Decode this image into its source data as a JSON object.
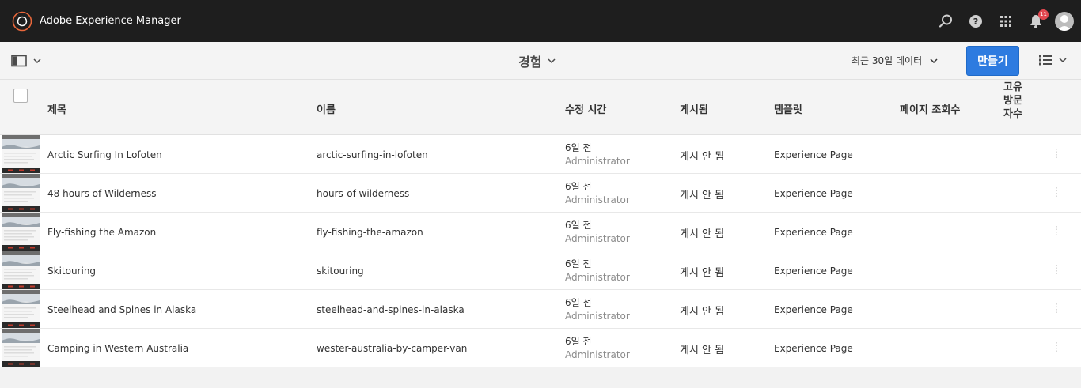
{
  "shell": {
    "app_title": "Adobe Experience Manager",
    "notification_count": "11",
    "icons": [
      "adobe-logo-icon",
      "search-icon",
      "help-icon",
      "solutions-grid-icon",
      "bell-icon",
      "user-avatar"
    ]
  },
  "actionbar": {
    "page_title": "경험",
    "period": "최근 30일 데이터",
    "create_label": "만들기"
  },
  "table": {
    "columns": {
      "title": "제목",
      "name": "이름",
      "modified": "수정 시간",
      "published": "게시됨",
      "template": "템플릿",
      "pageviews": "페이지 조회수",
      "unique_visitors": "고유방문자수"
    },
    "rows": [
      {
        "title": "Arctic Surfing In Lofoten",
        "name": "arctic-surfing-in-lofoten",
        "modified": "6일 전",
        "modified_by": "Administrator",
        "published": "게시 안 됨",
        "template": "Experience Page"
      },
      {
        "title": "48 hours of Wilderness",
        "name": "hours-of-wilderness",
        "modified": "6일 전",
        "modified_by": "Administrator",
        "published": "게시 안 됨",
        "template": "Experience Page"
      },
      {
        "title": "Fly-fishing the Amazon",
        "name": "fly-fishing-the-amazon",
        "modified": "6일 전",
        "modified_by": "Administrator",
        "published": "게시 안 됨",
        "template": "Experience Page"
      },
      {
        "title": "Skitouring",
        "name": "skitouring",
        "modified": "6일 전",
        "modified_by": "Administrator",
        "published": "게시 안 됨",
        "template": "Experience Page"
      },
      {
        "title": "Steelhead and Spines in Alaska",
        "name": "steelhead-and-spines-in-alaska",
        "modified": "6일 전",
        "modified_by": "Administrator",
        "published": "게시 안 됨",
        "template": "Experience Page"
      },
      {
        "title": "Camping in Western Australia",
        "name": "wester-australia-by-camper-van",
        "modified": "6일 전",
        "modified_by": "Administrator",
        "published": "게시 안 됨",
        "template": "Experience Page"
      }
    ]
  },
  "colors": {
    "shell_bg": "#1e1e1e",
    "accent": "#2d7be0",
    "badge": "#e34850",
    "logo_ring": "#e8673b"
  }
}
